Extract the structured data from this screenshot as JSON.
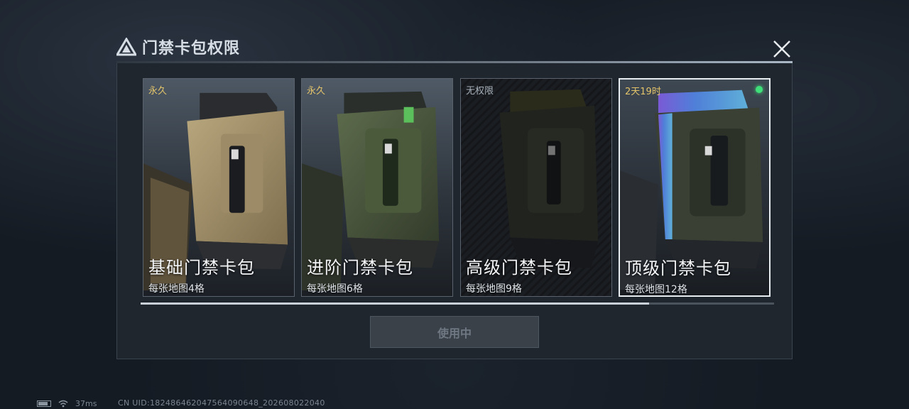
{
  "dialog": {
    "title": "门禁卡包权限",
    "close_icon": "close-icon",
    "title_icon": "triangle-logo-icon"
  },
  "cards": [
    {
      "status": "永久",
      "name": "基础门禁卡包",
      "desc": "每张地图4格",
      "theme": "sand"
    },
    {
      "status": "永久",
      "name": "进阶门禁卡包",
      "desc": "每张地图6格",
      "theme": "green"
    },
    {
      "status": "无权限",
      "name": "高级门禁卡包",
      "desc": "每张地图9格",
      "theme": "dark"
    },
    {
      "status": "2天19时",
      "name": "顶级门禁卡包",
      "desc": "每张地图12格",
      "theme": "holo",
      "selected": true,
      "active_indicator": "green-dot"
    }
  ],
  "use_button": {
    "label": "使用中"
  },
  "scroll": {
    "position_fraction": 0.8
  },
  "footer": {
    "ping": "37ms",
    "uid": "CN UID:1824864620475640906​48_202608022040"
  },
  "colors": {
    "status_gold": "#e3c36a",
    "active_dot": "#3fe07a",
    "panel_bg": "#20262e"
  }
}
